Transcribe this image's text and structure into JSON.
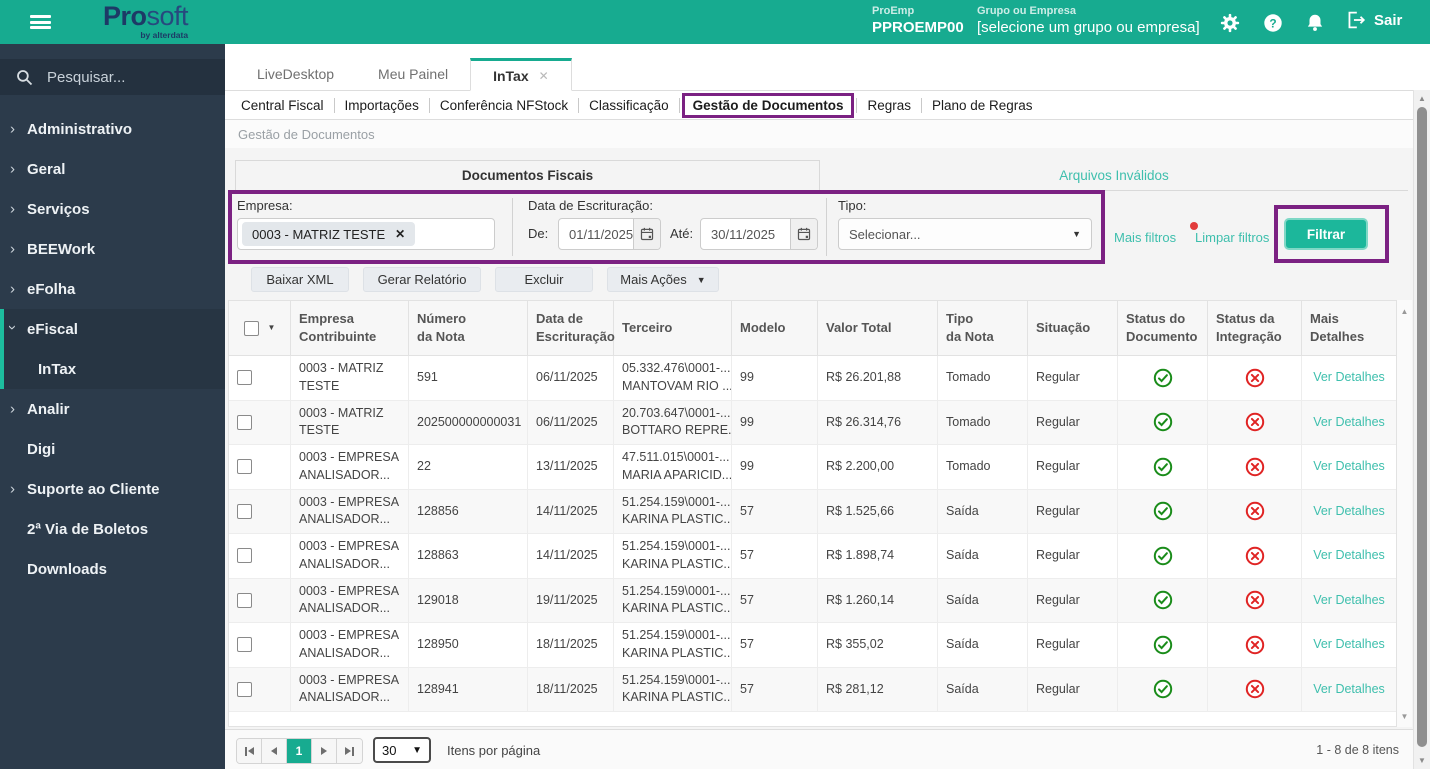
{
  "icons": {
    "close": "✕",
    "caret_down": "▼",
    "scroll_up": "▲",
    "scroll_down": "▼"
  },
  "topbar": {
    "brand_pro": "Pro",
    "brand_soft": "soft",
    "brand_byline": "by alterdata",
    "proemp_label": "ProEmp",
    "proemp_value": "PPROEMP00",
    "grupo_label": "Grupo ou Empresa",
    "grupo_value": "[selecione um grupo ou empresa]",
    "sair": "Sair"
  },
  "sidebar": {
    "search_placeholder": "Pesquisar...",
    "items": [
      {
        "label": "Administrativo",
        "chevron": "right"
      },
      {
        "label": "Geral",
        "chevron": "right"
      },
      {
        "label": "Serviços",
        "chevron": "right"
      },
      {
        "label": "BEEWork",
        "chevron": "right"
      },
      {
        "label": "eFolha",
        "chevron": "right"
      },
      {
        "label": "eFiscal",
        "chevron": "down",
        "group": true
      },
      {
        "label": "InTax",
        "child": true,
        "group": true
      },
      {
        "label": "Analir",
        "chevron": "right"
      },
      {
        "label": "Digi"
      },
      {
        "label": "Suporte ao Cliente",
        "chevron": "right"
      },
      {
        "label": "2ª Via de Boletos"
      },
      {
        "label": "Downloads"
      }
    ]
  },
  "tabs": [
    {
      "label": "LiveDesktop"
    },
    {
      "label": "Meu Painel"
    },
    {
      "label": "InTax",
      "active": true,
      "closable": true
    }
  ],
  "subnav": [
    {
      "label": "Central Fiscal"
    },
    {
      "label": "Importações"
    },
    {
      "label": "Conferência NFStock"
    },
    {
      "label": "Classificação"
    },
    {
      "label": "Gestão de Documentos",
      "active": true
    },
    {
      "label": "Regras"
    },
    {
      "label": "Plano de Regras"
    }
  ],
  "breadcrumb": "Gestão de Documentos",
  "panel_tabs": {
    "active": "Documentos Fiscais",
    "secondary": "Arquivos Inválidos"
  },
  "filters": {
    "empresa_label": "Empresa:",
    "empresa_chip": "0003 - MATRIZ TESTE",
    "data_label": "Data de Escrituração:",
    "de_label": "De:",
    "de_value": "01/11/2025",
    "ate_label": "Até:",
    "ate_value": "30/11/2025",
    "tipo_label": "Tipo:",
    "tipo_value": "Selecionar...",
    "mais_filtros": "Mais filtros",
    "limpar_filtros": "Limpar filtros",
    "filtrar": "Filtrar"
  },
  "actions": [
    "Baixar XML",
    "Gerar Relatório",
    "Excluir",
    "Mais Ações"
  ],
  "table": {
    "columns": [
      {
        "lines": [
          "Empresa",
          "Contribuinte"
        ]
      },
      {
        "lines": [
          "Número",
          "da Nota"
        ]
      },
      {
        "lines": [
          "Data de",
          "Escrituração"
        ]
      },
      {
        "lines": [
          "Terceiro"
        ]
      },
      {
        "lines": [
          "Modelo"
        ]
      },
      {
        "lines": [
          "Valor Total"
        ]
      },
      {
        "lines": [
          "Tipo",
          "da Nota"
        ]
      },
      {
        "lines": [
          "Situação"
        ]
      },
      {
        "lines": [
          "Status do",
          "Documento"
        ]
      },
      {
        "lines": [
          "Status da",
          "Integração"
        ]
      },
      {
        "lines": [
          "Mais Detalhes"
        ]
      }
    ],
    "rows": [
      {
        "empresa": [
          "0003 - MATRIZ",
          "TESTE"
        ],
        "numero": "591",
        "data": "06/11/2025",
        "terceiro": [
          "05.332.476\\0001-...",
          "MANTOVAM RIO ..."
        ],
        "modelo": "99",
        "valor": "R$ 26.201,88",
        "tipo": "Tomado",
        "situacao": "Regular",
        "status_documento": "ok",
        "status_integracao": "erro",
        "detalhes": "Ver Detalhes"
      },
      {
        "empresa": [
          "0003 - MATRIZ",
          "TESTE"
        ],
        "numero": "202500000000031",
        "data": "06/11/2025",
        "terceiro": [
          "20.703.647\\0001-...",
          "BOTTARO REPRE..."
        ],
        "modelo": "99",
        "valor": "R$ 26.314,76",
        "tipo": "Tomado",
        "situacao": "Regular",
        "status_documento": "ok",
        "status_integracao": "erro",
        "detalhes": "Ver Detalhes"
      },
      {
        "empresa": [
          "0003 - EMPRESA",
          "ANALISADOR..."
        ],
        "numero": "22",
        "data": "13/11/2025",
        "terceiro": [
          "47.511.015\\0001-...",
          "MARIA APARICID..."
        ],
        "modelo": "99",
        "valor": "R$ 2.200,00",
        "tipo": "Tomado",
        "situacao": "Regular",
        "status_documento": "ok",
        "status_integracao": "erro",
        "detalhes": "Ver Detalhes"
      },
      {
        "empresa": [
          "0003 - EMPRESA",
          "ANALISADOR..."
        ],
        "numero": "128856",
        "data": "14/11/2025",
        "terceiro": [
          "51.254.159\\0001-...",
          "KARINA PLASTIC..."
        ],
        "modelo": "57",
        "valor": "R$ 1.525,66",
        "tipo": "Saída",
        "situacao": "Regular",
        "status_documento": "ok",
        "status_integracao": "erro",
        "detalhes": "Ver Detalhes"
      },
      {
        "empresa": [
          "0003 - EMPRESA",
          "ANALISADOR..."
        ],
        "numero": "128863",
        "data": "14/11/2025",
        "terceiro": [
          "51.254.159\\0001-...",
          "KARINA PLASTIC..."
        ],
        "modelo": "57",
        "valor": "R$ 1.898,74",
        "tipo": "Saída",
        "situacao": "Regular",
        "status_documento": "ok",
        "status_integracao": "erro",
        "detalhes": "Ver Detalhes"
      },
      {
        "empresa": [
          "0003 - EMPRESA",
          "ANALISADOR..."
        ],
        "numero": "129018",
        "data": "19/11/2025",
        "terceiro": [
          "51.254.159\\0001-...",
          "KARINA PLASTIC..."
        ],
        "modelo": "57",
        "valor": "R$ 1.260,14",
        "tipo": "Saída",
        "situacao": "Regular",
        "status_documento": "ok",
        "status_integracao": "erro",
        "detalhes": "Ver Detalhes"
      },
      {
        "empresa": [
          "0003 - EMPRESA",
          "ANALISADOR..."
        ],
        "numero": "128950",
        "data": "18/11/2025",
        "terceiro": [
          "51.254.159\\0001-...",
          "KARINA PLASTIC..."
        ],
        "modelo": "57",
        "valor": "R$ 355,02",
        "tipo": "Saída",
        "situacao": "Regular",
        "status_documento": "ok",
        "status_integracao": "erro",
        "detalhes": "Ver Detalhes"
      },
      {
        "empresa": [
          "0003 - EMPRESA",
          "ANALISADOR..."
        ],
        "numero": "128941",
        "data": "18/11/2025",
        "terceiro": [
          "51.254.159\\0001-...",
          "KARINA PLASTIC..."
        ],
        "modelo": "57",
        "valor": "R$ 281,12",
        "tipo": "Saída",
        "situacao": "Regular",
        "status_documento": "ok",
        "status_integracao": "erro",
        "detalhes": "Ver Detalhes"
      }
    ]
  },
  "pagination": {
    "page": "1",
    "page_size": "30",
    "items_per_page_label": "Itens por página",
    "range_label": "1 - 8 de 8 itens"
  }
}
